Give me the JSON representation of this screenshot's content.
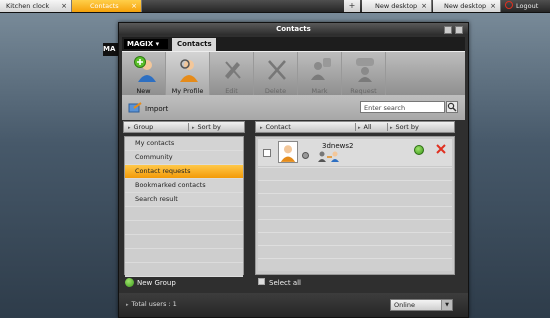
{
  "taskbar": {
    "tabs": [
      {
        "label": "Kitchen clock",
        "close": "×"
      },
      {
        "label": "Contacts",
        "close": "×"
      },
      {
        "label": "New desktop",
        "close": "×"
      },
      {
        "label": "New desktop",
        "close": "×"
      }
    ],
    "plus": "+",
    "logout": "Logout"
  },
  "desktop_ribbon": "MA",
  "window": {
    "title": "Contacts",
    "brand": "MAGIX",
    "tab": "Contacts",
    "toolbar": [
      {
        "label": "New",
        "icon": "new-contact-icon",
        "enabled": true
      },
      {
        "label": "My Profile",
        "icon": "profile-icon",
        "enabled": true
      },
      {
        "label": "Edit",
        "icon": "edit-icon",
        "enabled": false
      },
      {
        "label": "Delete",
        "icon": "delete-icon",
        "enabled": false
      },
      {
        "label": "Mark",
        "icon": "mark-icon",
        "enabled": false
      },
      {
        "label": "Request",
        "icon": "request-icon",
        "enabled": false
      }
    ],
    "import_label": "Import",
    "search_placeholder": "Enter search",
    "left_header": {
      "group": "Group",
      "sort": "Sort by"
    },
    "groups": [
      {
        "label": "My contacts",
        "active": false
      },
      {
        "label": "Community",
        "active": false
      },
      {
        "label": "Contact requests",
        "active": true
      },
      {
        "label": "Bookmarked contacts",
        "active": false
      },
      {
        "label": "Search result",
        "active": false
      }
    ],
    "right_header": {
      "contact": "Contact",
      "filter": "All",
      "sort": "Sort by"
    },
    "contacts": [
      {
        "name": "3dnews2",
        "status": "offline"
      }
    ],
    "new_group_label": "New Group",
    "select_all_label": "Select all",
    "total_users": "Total users : 1",
    "status_value": "Online"
  },
  "colors": {
    "accent": "#f5a10a",
    "accept": "#3c9a1b",
    "reject": "#e03020"
  }
}
